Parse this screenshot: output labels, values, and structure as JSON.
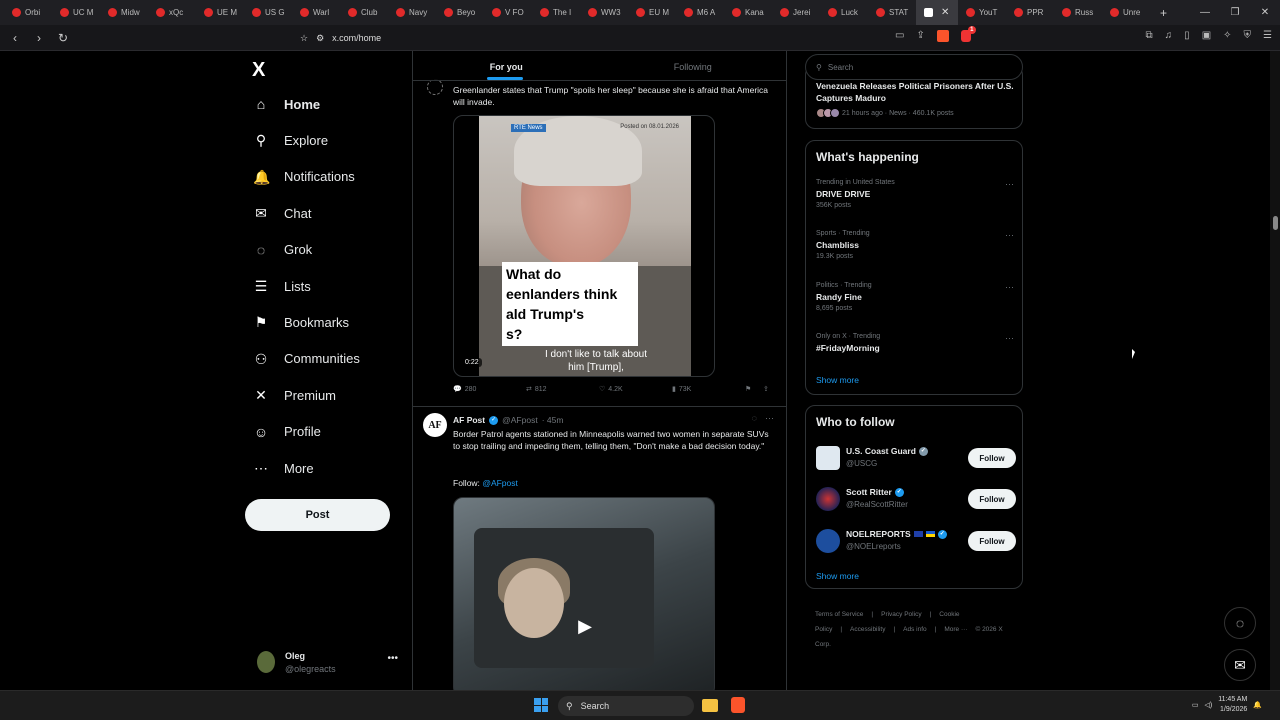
{
  "browser": {
    "tabs": [
      "Orbi",
      "UC M",
      "Midw",
      "xQc",
      "UE M",
      "US G",
      "Warl",
      "Club",
      "Navy",
      "Beyo",
      "V FO",
      "The I",
      "WW3",
      "EU M",
      "M6 A",
      "Kana",
      "Jerei",
      "Luck",
      "STAT",
      "",
      "YouT",
      "PPR",
      "Russ",
      "Unre"
    ],
    "active_tab_index": 19,
    "url": "x.com/home",
    "shield_badge": "1"
  },
  "nav": {
    "logo": "X",
    "items": [
      {
        "label": "Home",
        "icon": "home-icon",
        "glyph": "⌂"
      },
      {
        "label": "Explore",
        "icon": "search-icon",
        "glyph": "⚲"
      },
      {
        "label": "Notifications",
        "icon": "bell-icon",
        "glyph": "🔔"
      },
      {
        "label": "Chat",
        "icon": "mail-icon",
        "glyph": "✉"
      },
      {
        "label": "Grok",
        "icon": "grok-icon",
        "glyph": "◌"
      },
      {
        "label": "Lists",
        "icon": "list-icon",
        "glyph": "☰"
      },
      {
        "label": "Bookmarks",
        "icon": "bookmark-icon",
        "glyph": "⚑"
      },
      {
        "label": "Communities",
        "icon": "people-icon",
        "glyph": "⚇"
      },
      {
        "label": "Premium",
        "icon": "x-icon",
        "glyph": "✕"
      },
      {
        "label": "Profile",
        "icon": "person-icon",
        "glyph": "☺"
      },
      {
        "label": "More",
        "icon": "more-circle-icon",
        "glyph": "⋯"
      }
    ],
    "post_label": "Post",
    "user": {
      "name": "Oleg",
      "handle": "@olegreacts"
    }
  },
  "feed": {
    "tabs": [
      "For you",
      "Following"
    ],
    "tweet1": {
      "text": "Greenlander states that Trump \"spoils her sleep\" because she is afraid that America will invade.",
      "video": {
        "source_tag": "RTE News",
        "posted": "Posted on 08.01.2026",
        "caption_lines": [
          "What do",
          "eenlanders think",
          "ald Trump's",
          "s?"
        ],
        "subtitle": "I don't like to talk about him [Trump],",
        "duration": "0:22"
      },
      "stats": {
        "replies": "280",
        "reposts": "812",
        "likes": "4.2K",
        "views": "73K"
      }
    },
    "tweet2": {
      "avatar_text": "AF",
      "name": "AF Post",
      "handle": "@AFpost",
      "time": "· 45m",
      "text": "Border Patrol agents stationed in Minneapolis warned two women in separate SUVs to stop trailing and impeding them, telling them, \"Don't make a bad decision today.\"",
      "follow_prefix": "Follow:",
      "follow_handle": "@AFpost"
    }
  },
  "sidebar": {
    "search_placeholder": "Search",
    "news": {
      "title": "Venezuela Releases Political Prisoners After U.S. Captures Maduro",
      "meta": "21 hours ago · News · 460.1K posts"
    },
    "happening": {
      "title": "What's happening",
      "trends": [
        {
          "meta": "Trending in United States",
          "name": "DRIVE DRIVE",
          "posts": "356K posts"
        },
        {
          "meta": "Sports · Trending",
          "name": "Chambliss",
          "posts": "19.3K posts"
        },
        {
          "meta": "Politics · Trending",
          "name": "Randy Fine",
          "posts": "8,695 posts"
        },
        {
          "meta": "Only on X · Trending",
          "name": "#FridayMorning",
          "posts": ""
        }
      ],
      "show_more": "Show more"
    },
    "who_to_follow": {
      "title": "Who to follow",
      "accounts": [
        {
          "name": "U.S. Coast Guard",
          "handle": "@USCG"
        },
        {
          "name": "Scott Ritter",
          "handle": "@RealScottRitter"
        },
        {
          "name": "NOELREPORTS",
          "handle": "@NOELreports"
        }
      ],
      "follow_label": "Follow",
      "show_more": "Show more"
    },
    "footer": [
      "Terms of Service",
      "|",
      "Privacy Policy",
      "|",
      "Cookie Policy",
      "|",
      "Accessibility",
      "|",
      "Ads info",
      "|",
      "More ···",
      "© 2026 X Corp."
    ]
  },
  "taskbar": {
    "search": "Search",
    "time": "11:45 AM",
    "date": "1/9/2026"
  }
}
